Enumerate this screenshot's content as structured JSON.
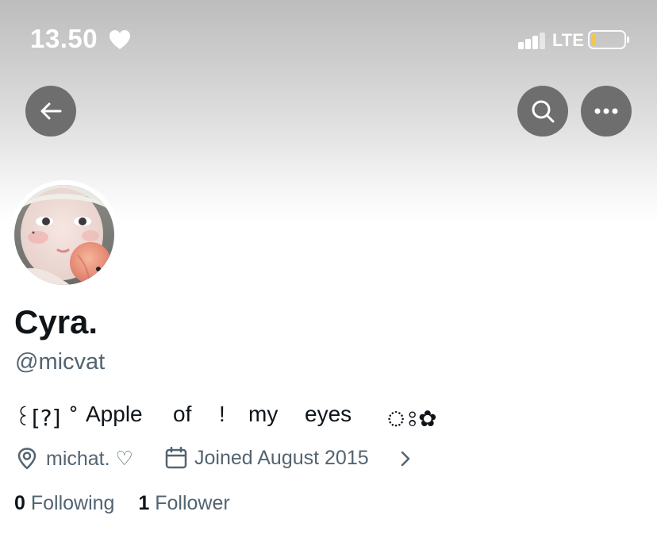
{
  "status_bar": {
    "time": "13.50",
    "heart_icon": "heart-icon",
    "network": "LTE",
    "battery_color": "#f2c94c"
  },
  "nav": {
    "back_icon": "arrow-left-icon",
    "search_icon": "search-icon",
    "more_icon": "more-horizontal-icon",
    "button_color": "#6e6e6e"
  },
  "profile": {
    "display_name": "Cyra.",
    "handle": "@micvat",
    "bio": {
      "prefix_symbols": "꒰[?] ˚",
      "words": [
        "Apple",
        "of",
        "!",
        "my",
        "eyes"
      ],
      "suffix_symbols": "ঃ✿"
    },
    "location": "michat. ♡",
    "joined": "Joined August 2015"
  },
  "stats": {
    "following_count": "0",
    "following_label": "Following",
    "followers_count": "1",
    "followers_label": "Follower"
  },
  "colors": {
    "primary_text": "#0f1419",
    "secondary_text": "#536471"
  }
}
